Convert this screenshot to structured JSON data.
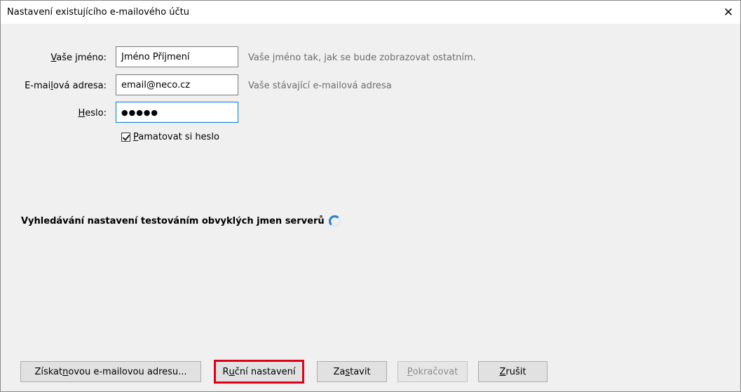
{
  "window": {
    "title": "Nastavení existujícího e-mailového účtu",
    "close_glyph": "✕"
  },
  "form": {
    "name": {
      "label_pre": "",
      "label_key": "V",
      "label_post": "aše jméno:",
      "value": "Jméno Příjmení",
      "hint": "Vaše jméno tak, jak se bude zobrazovat ostatním."
    },
    "email": {
      "label_pre": "E-mai",
      "label_key": "l",
      "label_post": "ová adresa:",
      "value": "email@neco.cz",
      "hint": "Vaše stávající e-mailová adresa"
    },
    "password": {
      "label_pre": "",
      "label_key": "H",
      "label_post": "eslo:",
      "value": "●●●●●"
    },
    "remember": {
      "checked": true,
      "label_pre": "",
      "label_key": "P",
      "label_post": "amatovat si heslo"
    }
  },
  "status": {
    "text": "Vyhledávání nastavení testováním obvyklých jmen serverů",
    "icon": "loading-spinner-icon"
  },
  "buttons": {
    "new_address": {
      "pre": "Získat ",
      "key": "n",
      "post": "ovou e-mailovou adresu..."
    },
    "manual": {
      "pre": "R",
      "key": "u",
      "post": "ční nastavení"
    },
    "stop": {
      "pre": "Za",
      "key": "s",
      "post": "tavit"
    },
    "continue": {
      "pre": "",
      "key": "P",
      "post": "okračovat"
    },
    "cancel": {
      "pre": "",
      "key": "Z",
      "post": "rušit"
    }
  },
  "colors": {
    "highlight_border": "#e0001a",
    "spinner": "#1e7fd9",
    "focus_border": "#0078d7"
  }
}
